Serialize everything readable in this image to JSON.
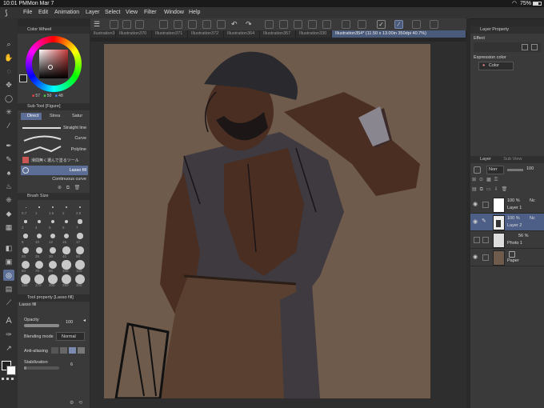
{
  "status_bar": {
    "time": "10:01 PM",
    "date": "Mon Mar 7",
    "battery": "75%"
  },
  "menu": [
    "File",
    "Edit",
    "Animation",
    "Layer",
    "Select",
    "View",
    "Filter",
    "Window",
    "Help"
  ],
  "tabs": [
    {
      "label": "llustration369",
      "active": false
    },
    {
      "label": "Illustration370",
      "active": false
    },
    {
      "label": "Illustration371",
      "active": false
    },
    {
      "label": "Illustration372",
      "active": false
    },
    {
      "label": "Illustration364",
      "active": false
    },
    {
      "label": "Illustration357",
      "active": false
    },
    {
      "label": "Illustration330",
      "active": false
    },
    {
      "label": "Illustration354* (11.50 x 13.00in 350dpi 40.7%)",
      "active": true
    }
  ],
  "color_wheel": {
    "title": "Color Wheel",
    "h": "57",
    "s": "50",
    "v": "48",
    "main_color": "#222222",
    "sub_color": "#ffffff"
  },
  "sub_tool": {
    "title": "Sub Tool [Figure]",
    "tabs": [
      "Direct",
      "Strea",
      "Satur"
    ],
    "items": [
      "Straight line",
      "Curve",
      "Polyline",
      "滑間無く選んで塗るツール",
      "Lasso fill",
      "Continuous curve"
    ]
  },
  "brush_size": {
    "title": "Brush Size",
    "sizes": [
      "0.7",
      "1",
      "1.5",
      "2",
      "2.5",
      "3",
      "4",
      "5",
      "6",
      "7",
      "8",
      "10",
      "12",
      "15",
      "17",
      "20",
      "25",
      "30",
      "40",
      "50",
      "60",
      "70",
      "80",
      "100",
      "120",
      "150",
      "170",
      "200",
      "250",
      "300"
    ]
  },
  "tool_property": {
    "title": "Tool property [Lasso fill]",
    "tool_name": "Lasso fill",
    "opacity_label": "Opacity",
    "opacity_value": "100",
    "opacity_level": 1.0,
    "blending_label": "Blending mode",
    "blending_value": "Normal",
    "antialias_label": "Anti-aliasing",
    "stabilization_label": "Stabilization",
    "stabilization_value": "6",
    "stabilization_level": 0.06
  },
  "layer_property": {
    "title": "Layer Property",
    "effect_label": "Effect",
    "expression_label": "Expression color",
    "expression_value": "Color"
  },
  "layer_panel": {
    "tabs": [
      "Layer",
      "Sub View"
    ],
    "blend_mode": "Norr",
    "opacity": "100",
    "layers": [
      {
        "opacity": "100 %",
        "mode": "Nc",
        "name": "Layer 1",
        "selected": false
      },
      {
        "opacity": "100 %",
        "mode": "Nc",
        "name": "Layer 2",
        "selected": true
      },
      {
        "opacity": "56 %",
        "mode": "",
        "name": "Photo 1",
        "selected": false
      },
      {
        "opacity": "",
        "mode": "",
        "name": "Paper",
        "selected": false
      }
    ]
  },
  "colors": {
    "accent": "#5c6e96",
    "canvas_bg": "#6f5b4c",
    "panel_bg": "#3a3a3a"
  }
}
